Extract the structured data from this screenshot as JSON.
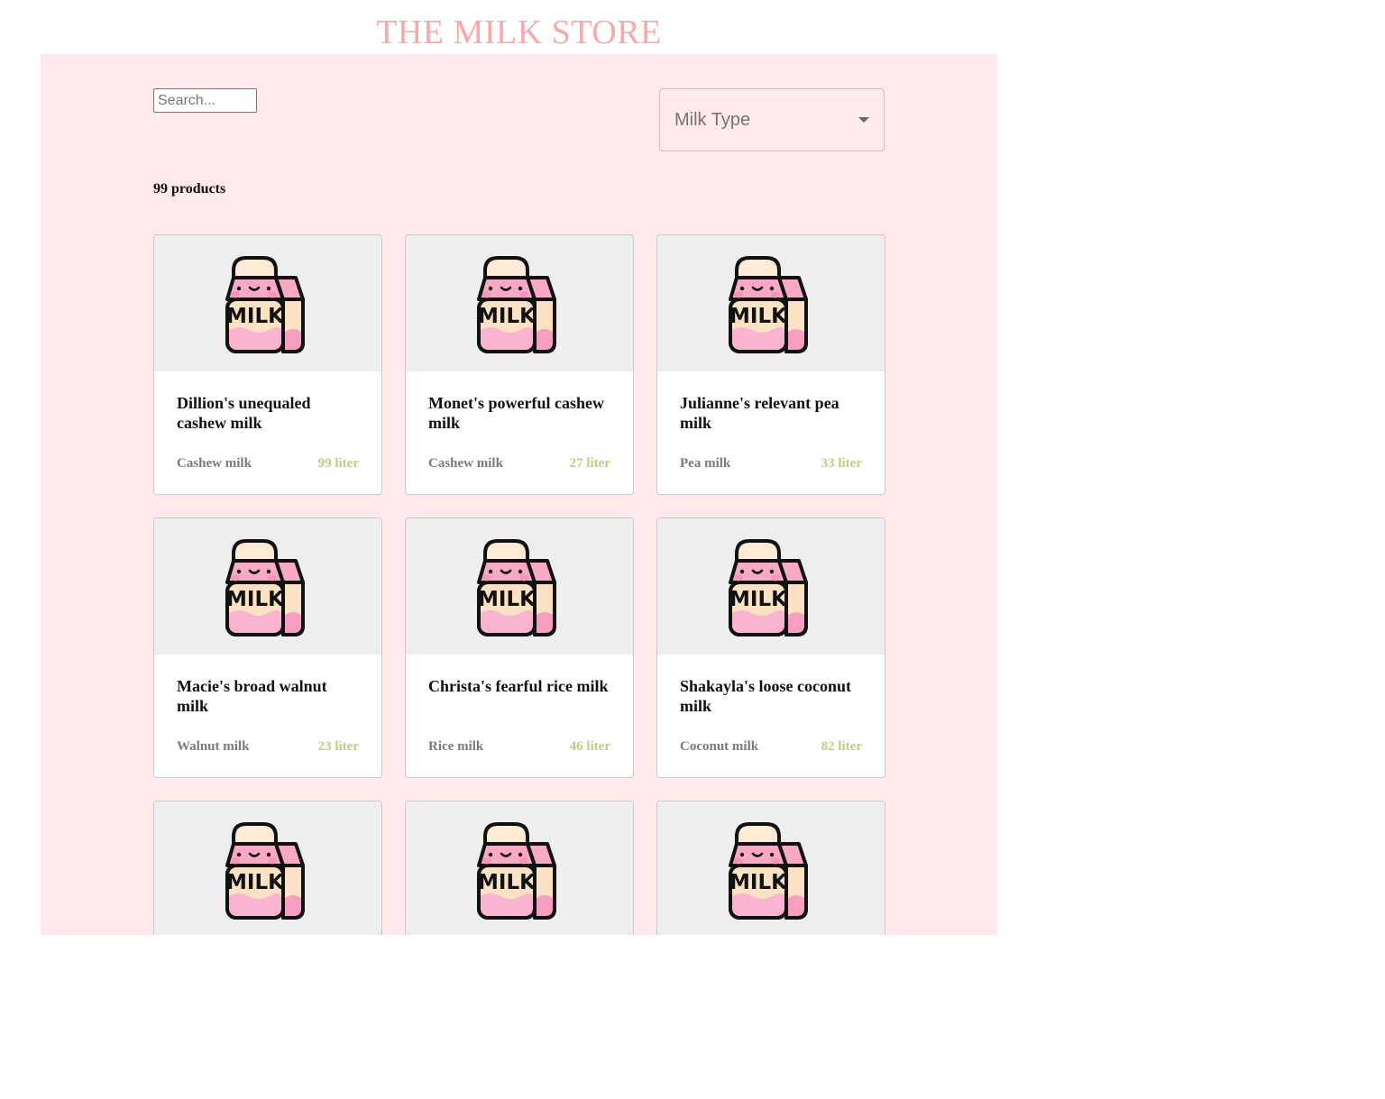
{
  "store": {
    "title": "THE MILK STORE"
  },
  "search": {
    "placeholder": "Search...",
    "value": ""
  },
  "filter": {
    "label": "Milk Type"
  },
  "summary": {
    "count_text": "99 products"
  },
  "colors": {
    "accent": "#f7a9ab",
    "panel_bg": "#ffe9ea",
    "quantity": "#b8d27a"
  },
  "product_icon": "milk-carton-icon",
  "products": [
    {
      "name": "Dillion's unequaled cashew milk",
      "type": "Cashew milk",
      "quantity": "99 liter"
    },
    {
      "name": "Monet's powerful cashew milk",
      "type": "Cashew milk",
      "quantity": "27 liter"
    },
    {
      "name": "Julianne's relevant pea milk",
      "type": "Pea milk",
      "quantity": "33 liter"
    },
    {
      "name": "Macie's broad walnut milk",
      "type": "Walnut milk",
      "quantity": "23 liter"
    },
    {
      "name": "Christa's fearful rice milk",
      "type": "Rice milk",
      "quantity": "46 liter"
    },
    {
      "name": "Shakayla's loose coconut milk",
      "type": "Coconut milk",
      "quantity": "82 liter"
    },
    {
      "name": "",
      "type": "",
      "quantity": ""
    },
    {
      "name": "",
      "type": "",
      "quantity": ""
    },
    {
      "name": "",
      "type": "",
      "quantity": ""
    }
  ]
}
